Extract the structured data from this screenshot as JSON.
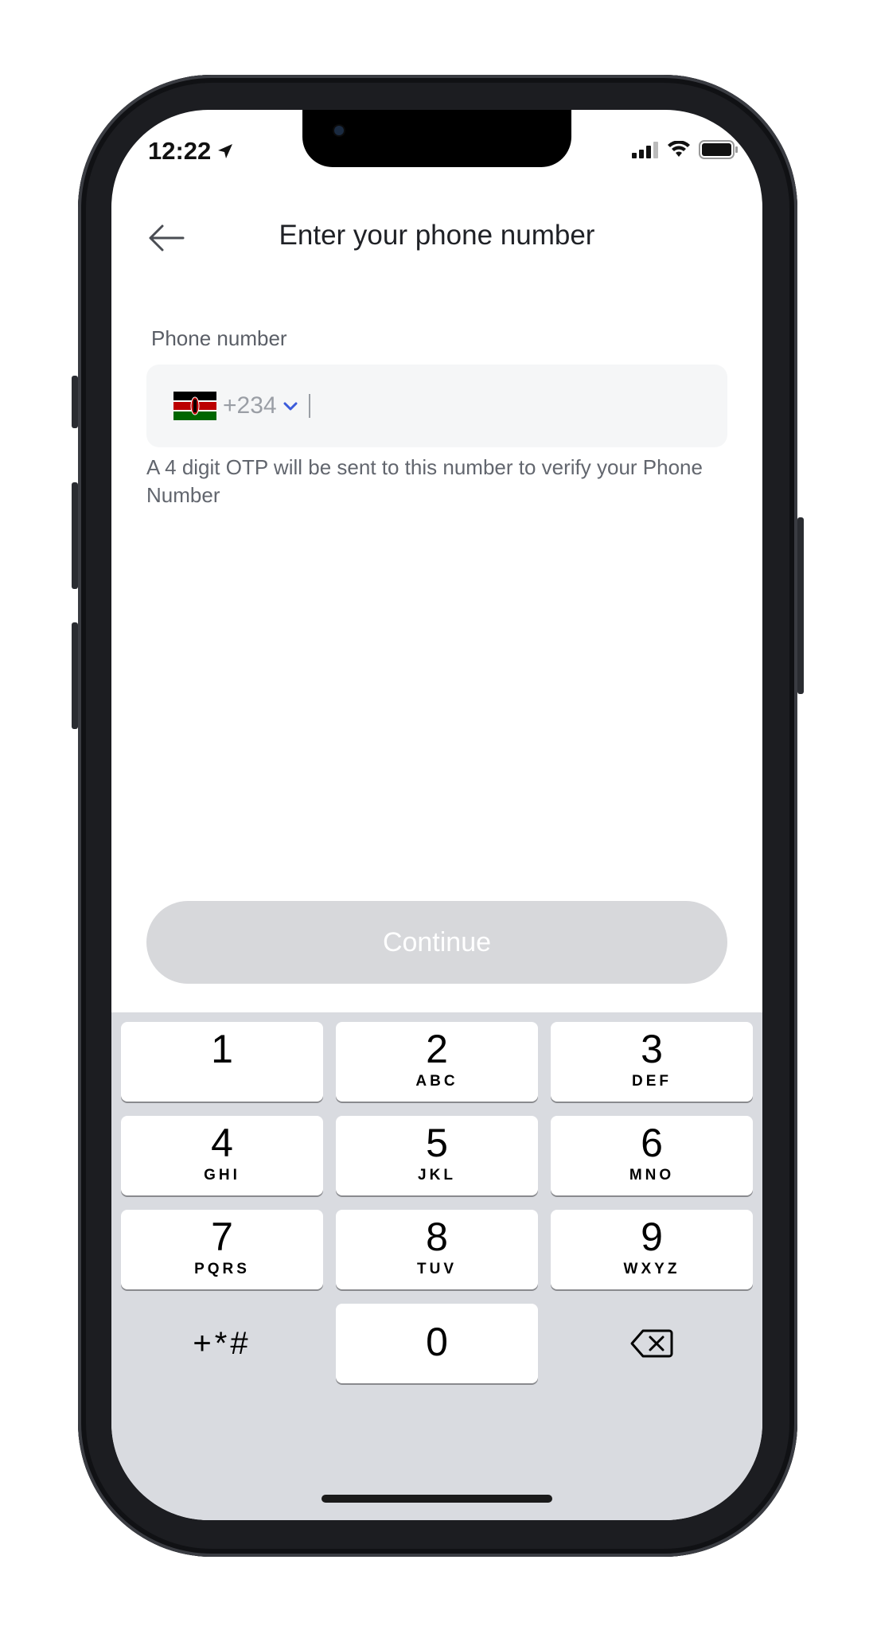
{
  "status_bar": {
    "time": "12:22"
  },
  "header": {
    "title": "Enter your phone number"
  },
  "form": {
    "phone_label": "Phone number",
    "dial_code": "+234",
    "helper_text": "A 4 digit OTP will be sent to this number to verify your Phone Number"
  },
  "actions": {
    "continue_label": "Continue"
  },
  "keypad": {
    "keys": [
      {
        "num": "1",
        "letters": ""
      },
      {
        "num": "2",
        "letters": "ABC"
      },
      {
        "num": "3",
        "letters": "DEF"
      },
      {
        "num": "4",
        "letters": "GHI"
      },
      {
        "num": "5",
        "letters": "JKL"
      },
      {
        "num": "6",
        "letters": "MNO"
      },
      {
        "num": "7",
        "letters": "PQRS"
      },
      {
        "num": "8",
        "letters": "TUV"
      },
      {
        "num": "9",
        "letters": "WXYZ"
      },
      {
        "num": "0",
        "letters": ""
      }
    ],
    "symbols_label": "+*#"
  },
  "colors": {
    "accent": "#3b5bdb",
    "continue_disabled": "#d7d8db",
    "keyboard_bg": "#d9dbe0",
    "input_bg": "#f5f6f7"
  },
  "icons": {
    "back": "arrow-left-icon",
    "dropdown": "chevron-down-icon",
    "location": "location-arrow-icon",
    "signal": "cellular-signal-icon",
    "wifi": "wifi-icon",
    "battery": "battery-icon",
    "delete": "backspace-icon",
    "flag": "kenya-flag-icon"
  }
}
